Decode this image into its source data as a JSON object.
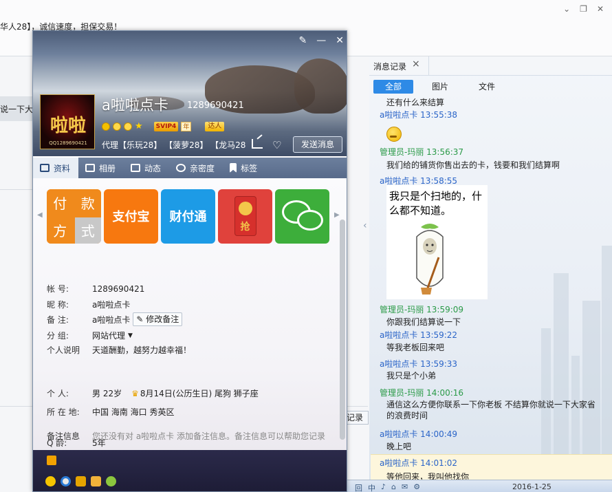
{
  "background": {
    "notice": "华人28】，诚信速度，担保交易！",
    "left_text": "说一下大",
    "record_btn": "记录",
    "taskbar_items": [
      "回",
      "中",
      "♪",
      "⌂",
      "✉",
      "⚙"
    ],
    "clock": "2016-1-25"
  },
  "message_panel": {
    "tab_label": "消息记录",
    "filters": [
      "全部",
      "图片",
      "文件"
    ],
    "meme_text": "我只是个扫地的，什么都不知道。",
    "messages": [
      {
        "type": "body",
        "text": "还有什么来结算"
      },
      {
        "type": "head",
        "role": "self",
        "text": "a啦啦点卡 13:55:38"
      },
      {
        "type": "head",
        "role": "other",
        "text": "管理员-玛丽 13:56:37"
      },
      {
        "type": "body",
        "text": "我们给的铺货你售出去的卡，钱要和我们结算啊"
      },
      {
        "type": "head",
        "role": "self",
        "text": "a啦啦点卡 13:58:55"
      },
      {
        "type": "head",
        "role": "other",
        "text": "管理员-玛丽 13:59:09"
      },
      {
        "type": "body",
        "text": "你跟我们结算说一下"
      },
      {
        "type": "head",
        "role": "self",
        "text": "a啦啦点卡 13:59:22"
      },
      {
        "type": "body",
        "text": "等我老板回来吧"
      },
      {
        "type": "head",
        "role": "self",
        "text": "a啦啦点卡 13:59:33"
      },
      {
        "type": "body",
        "text": "我只是个小弟"
      },
      {
        "type": "head",
        "role": "other",
        "text": "管理员-玛丽 14:00:16"
      },
      {
        "type": "body",
        "text": "通信这么方便你联系一下你老板  不结算你就说一下大家省的浪费时间"
      },
      {
        "type": "head",
        "role": "self",
        "text": "a啦啦点卡 14:00:49"
      },
      {
        "type": "body",
        "text": "晚上吧"
      },
      {
        "type": "head",
        "role": "self",
        "text": "a啦啦点卡 14:01:02"
      },
      {
        "type": "body",
        "text": "等他回来，我叫他找你"
      }
    ]
  },
  "card": {
    "avatar_text": "啦啦",
    "avatar_sub": "QQ1289690421",
    "nickname": "a啦啦点卡",
    "qq_number": "1289690421",
    "vip": "SVIP4",
    "vip_year": "年",
    "daren": "达人",
    "groups": "代理【乐玩28】 【菠萝28】 【龙马28...",
    "send_button": "发送消息",
    "tabs": [
      "资料",
      "相册",
      "动态",
      "亲密度",
      "标签"
    ],
    "apps": {
      "pay_chars": [
        "付",
        "款",
        "方",
        "式"
      ],
      "alipay": "支付宝",
      "caifutong": "财付通",
      "red_char": "抢"
    },
    "fields": {
      "account_k": "帐    号:",
      "account_v": "1289690421",
      "nick_k": "昵    称:",
      "nick_v": "a啦啦点卡",
      "remark_k": "备    注:",
      "remark_v": "a啦啦点卡",
      "remark_btn": "修改备注",
      "group_k": "分    组:",
      "group_v": "网站代理",
      "sign_k": "个人说明",
      "sign_v": "天道酬勤，越努力越幸福！",
      "person_k": "个    人:",
      "person_v": "男   22岁",
      "birthday": "8月14日(公历生日)    尾狗    狮子座",
      "location_k": "所 在 地:",
      "location_v": "中国 海南 海口 秀英区",
      "age_k": "Q      龄:",
      "age_v": "5年",
      "note_k": "备注信息",
      "note_v": "您还没有对 a啦啦点卡 添加备注信息。备注信息可以帮助您记录"
    }
  },
  "colors": {
    "accent_blue": "#2e8ae6",
    "self_name": "#2a64c8",
    "other_name": "#2a9a47"
  }
}
